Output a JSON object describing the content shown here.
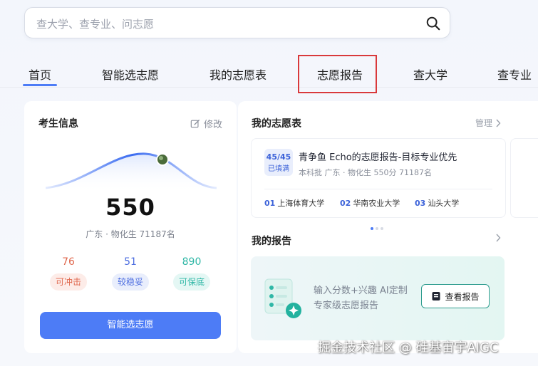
{
  "search": {
    "placeholder": "查大学、查专业、问志愿"
  },
  "tabs": [
    "首页",
    "智能选志愿",
    "我的志愿表",
    "志愿报告",
    "查大学",
    "查专业"
  ],
  "candidate": {
    "title": "考生信息",
    "edit_label": "修改",
    "score": "550",
    "profile": "广东 · 物化生 71187名",
    "stats": [
      {
        "value": "76",
        "label": "可冲击",
        "color": "#e0694f"
      },
      {
        "value": "51",
        "label": "较稳妥",
        "color": "#4d6ee0"
      },
      {
        "value": "890",
        "label": "可保底",
        "color": "#2fb7a6"
      }
    ],
    "smart_button": "智能选志愿"
  },
  "my_plan": {
    "title": "我的志愿表",
    "manage_label": "管理",
    "card": {
      "count": "45/45",
      "status": "已填满",
      "title": "青争鱼 Echo的志愿报告-目标专业优先",
      "meta": "本科批 广东 · 物化生 550分 71187名",
      "universities": [
        {
          "index": "01",
          "name": "上海体育大学"
        },
        {
          "index": "02",
          "name": "华南农业大学"
        },
        {
          "index": "03",
          "name": "汕头大学"
        }
      ]
    }
  },
  "my_report": {
    "title": "我的报告",
    "description": "输入分数+兴趣 AI定制专家级志愿报告",
    "view_button": "查看报告"
  },
  "watermark": "掘金技术社区 @ 硅基宙宇AIGC",
  "colors": {
    "accent": "#4d7cf6",
    "teal": "#2f9d8f",
    "highlight": "#d9393b"
  }
}
